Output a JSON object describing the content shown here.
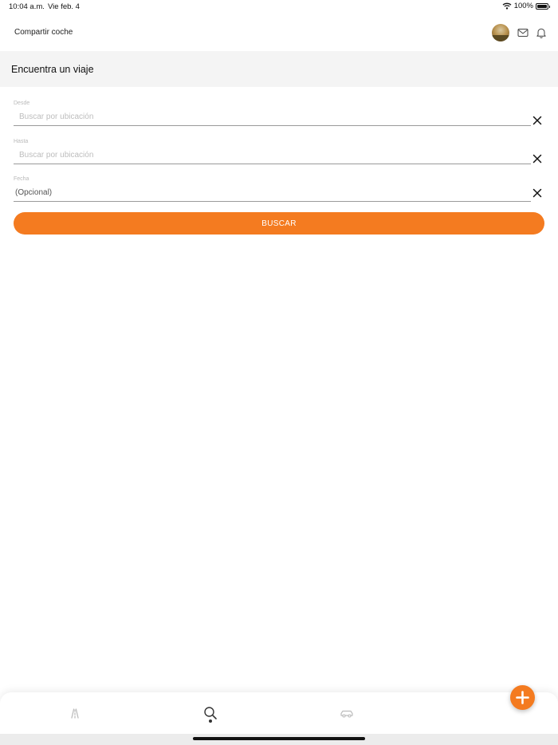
{
  "status_bar": {
    "time": "10:04 a.m.",
    "date": "Vie feb. 4",
    "battery": "100%"
  },
  "nav": {
    "title": "Compartir coche"
  },
  "header": {
    "title": "Encuentra un viaje"
  },
  "form": {
    "from": {
      "label": "Desde",
      "placeholder": "Buscar por ubicación"
    },
    "to": {
      "label": "Hasta",
      "placeholder": "Buscar por ubicación"
    },
    "date": {
      "label": "Fecha",
      "value": "(Opcional)"
    },
    "submit_label": "BUSCAR"
  },
  "tab_bar": {
    "tabs": [
      {
        "icon": "road-icon",
        "active": false
      },
      {
        "icon": "search-icon",
        "active": true
      },
      {
        "icon": "car-icon",
        "active": false
      }
    ]
  },
  "colors": {
    "accent": "#f47b20",
    "section_bg": "#f4f4f4"
  }
}
